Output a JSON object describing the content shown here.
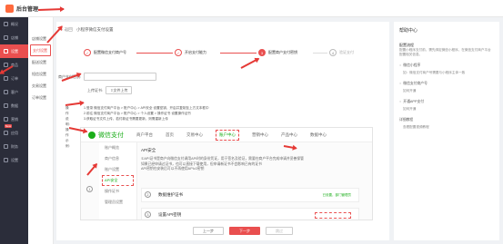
{
  "app": {
    "title": "后台管理"
  },
  "sidebar": {
    "items": [
      {
        "label": "概况",
        "icon": "home-icon"
      },
      {
        "label": "店铺",
        "icon": "store-icon"
      },
      {
        "label": "设置",
        "icon": "settings-icon",
        "active": true
      },
      {
        "label": "商品",
        "icon": "goods-icon"
      },
      {
        "label": "订单",
        "icon": "order-icon"
      },
      {
        "label": "客户",
        "icon": "user-icon"
      },
      {
        "label": "数据",
        "icon": "data-icon"
      },
      {
        "label": "营销",
        "icon": "marketing-icon"
      },
      {
        "label": "应用",
        "icon": "apps-icon",
        "badge": "New"
      },
      {
        "label": "财务",
        "icon": "finance-icon"
      },
      {
        "label": "设置",
        "icon": "gear-icon"
      }
    ]
  },
  "subnav": {
    "items": [
      {
        "label": "店铺设置"
      },
      {
        "label": "支付设置",
        "active": true
      },
      {
        "label": "配送设置"
      },
      {
        "label": "短信设置"
      },
      {
        "label": "交易设置"
      },
      {
        "label": "订单设置"
      }
    ]
  },
  "main": {
    "back": "返回",
    "crumb": "小程序微信支付设置",
    "steps": [
      {
        "num": "✓",
        "label": "配置微信支付商户号",
        "state": "done"
      },
      {
        "num": "✓",
        "label": "开启支付能力",
        "state": "done"
      },
      {
        "num": "3",
        "label": "配置商户支付密钥",
        "state": "cur"
      },
      {
        "num": "4",
        "label": "验证支付",
        "state": "todo"
      }
    ],
    "merchant_label": "商户支付密钥:",
    "merchant_placeholder": "",
    "cert_label": "上传证书:",
    "upload_label": "文件上传",
    "notes_label": "操作说明:",
    "notes": [
      "1.登录 微信支付商户平台 > 账户中心 > API安全 设置密钥，开启并复制至上方文本框中",
      "2.前往 微信支付商户平台 > 账户中心 > 个人设置 > 操作证书 设置操作证书",
      "3.获取证书文件上传，若付款证书需要更新，则需重新上传"
    ],
    "example_label": "操作示例:",
    "wx": {
      "brand": "微信支付",
      "nav": [
        "商户平台",
        "首页",
        "交易中心",
        "账户中心",
        "营销中心",
        "产品中心",
        "数据中心"
      ],
      "left": [
        "账户概览",
        "商户信息",
        "账户设置",
        "API安全",
        "操作证书",
        "管理员设置"
      ],
      "section": "API安全",
      "text": [
        "①API证书是商户向微信支付调用API时的身份凭证，用于签名及验证，需要在商户平台完成申请并妥善保管",
        "如果已经申请过证书，也可以直接下载使用，但申请新证书不会影响已有的证书",
        "API密钥在安装后可以不再使用APIv2密钥"
      ],
      "cards": [
        {
          "label": "数据维护证书",
          "tag": "已设置，部门管理员"
        },
        {
          "label": "设置API密钥"
        }
      ],
      "circle_nums": [
        "1",
        "2",
        "3"
      ]
    },
    "buttons": {
      "prev": "上一步",
      "next": "下一步",
      "skip": "跳过"
    }
  },
  "help": {
    "title": "帮助中心",
    "h1": "配置流程",
    "t1": "配置小程序支付前，需先绑定微信小程序，在微信支付商户平台配置相关信息。",
    "links": [
      {
        "label": "微信小程序",
        "sub": "如：微信支付商户号需要与小程序主体一致"
      },
      {
        "label": "微信支付商户号",
        "sub": "如何开通"
      },
      {
        "label": "开通APP支付",
        "sub": "如何开通"
      },
      {
        "label": "详细教程",
        "sub": "查看配置视频教程"
      }
    ]
  },
  "colors": {
    "accent": "#e94f4f",
    "sidebar": "#2b2d3a",
    "wechat": "#1aad19",
    "annotation": "#e53935"
  }
}
